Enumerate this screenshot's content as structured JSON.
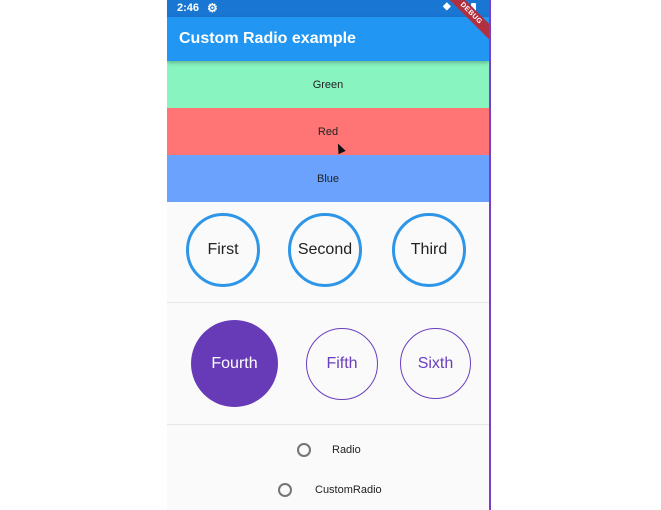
{
  "status_bar": {
    "time": "2:46",
    "gear_icon": "gear-icon",
    "wifi_icon": "wifi-icon",
    "battery_icon": "battery-icon"
  },
  "app_bar": {
    "title": "Custom Radio example",
    "debug_label": "DEBUG"
  },
  "color_options": [
    {
      "label": "Green",
      "color": "#88f5c0"
    },
    {
      "label": "Red",
      "color": "#ff7474"
    },
    {
      "label": "Blue",
      "color": "#6aa2fe"
    }
  ],
  "ring_options": [
    "First",
    "Second",
    "Third"
  ],
  "filled_options": [
    {
      "label": "Fourth",
      "selected": true
    },
    {
      "label": "Fifth",
      "selected": false
    },
    {
      "label": "Sixth",
      "selected": false
    }
  ],
  "radio_list": [
    {
      "label": "Radio",
      "selected": false
    },
    {
      "label": "CustomRadio",
      "selected": false
    }
  ],
  "colors": {
    "app_bar": "#2196f3",
    "status_bar": "#1976d2",
    "ring_accent": "#2e96e8",
    "purple_accent": "#673ab7"
  }
}
